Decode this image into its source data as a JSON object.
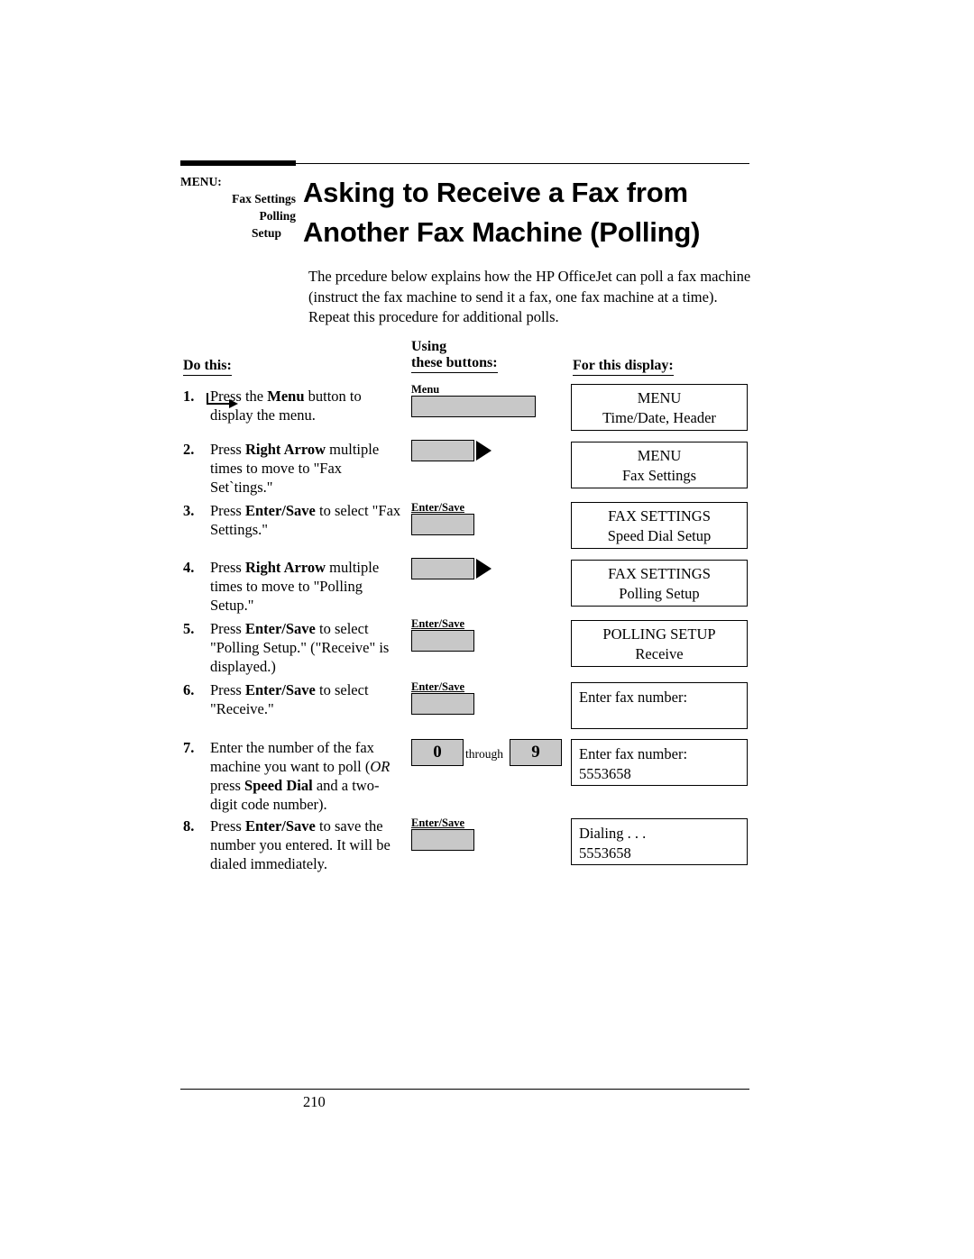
{
  "breadcrumb": {
    "line1": "MENU:",
    "line2": "Fax Settings",
    "line3": "Polling",
    "line4": "Setup"
  },
  "title": {
    "line1": "Asking to Receive a Fax from",
    "line2": "Another Fax Machine (Polling)"
  },
  "intro": "The prcedure below explains how the HP OfficeJet can poll a fax machine (instruct the fax machine to send it a fax, one fax machine at a time). Repeat this procedure for additional polls.",
  "columns": {
    "do_this": "Do this:",
    "using_line1": "Using",
    "using_line2": "these buttons:",
    "for_this_display": "For this display:"
  },
  "steps": [
    {
      "num": "1.",
      "text_parts": [
        "Press the ",
        "Menu",
        " button to display the menu."
      ],
      "button_label": "Menu",
      "display_line1": "MENU",
      "display_line2": "Time/Date, Header"
    },
    {
      "num": "2.",
      "text_parts": [
        "Press ",
        "Right Arrow",
        " multiple times to move to \"Fax Set`tings.\""
      ],
      "button_label": "",
      "display_line1": "MENU",
      "display_line2": "Fax Settings"
    },
    {
      "num": "3.",
      "text_parts": [
        "Press ",
        "Enter/Save",
        " to select \"Fax Settings.\""
      ],
      "button_label": "Enter/Save",
      "display_line1": "FAX  SETTINGS",
      "display_line2": "Speed Dial Setup"
    },
    {
      "num": "4.",
      "text_parts": [
        "Press ",
        "Right Arrow",
        " multiple times to move to \"Polling Setup.\""
      ],
      "button_label": "",
      "display_line1": "FAX  SETTINGS",
      "display_line2": "Polling Setup"
    },
    {
      "num": "5.",
      "text_parts": [
        "Press ",
        "Enter/Save",
        " to select \"Polling Setup.\" (\"Receive\" is displayed.)"
      ],
      "button_label": "Enter/Save",
      "display_line1": "POLLING  SETUP",
      "display_line2": "Receive"
    },
    {
      "num": "6.",
      "text_parts": [
        "Press ",
        "Enter/Save",
        " to select \"Receive.\""
      ],
      "button_label": "Enter/Save",
      "display_line1": "Enter fax number:",
      "display_line2": ""
    },
    {
      "num": "7.",
      "text_parts": [
        "Enter the number of the fax machine you want to poll (",
        "OR",
        " press ",
        "Speed Dial",
        " and a two-digit code number)."
      ],
      "keypad_from": "0",
      "keypad_through": "through",
      "keypad_to": "9",
      "display_line1": "Enter fax number:",
      "display_line2": "5553658"
    },
    {
      "num": "8.",
      "text_parts": [
        "Press ",
        "Enter/Save",
        " to save the number you entered. It will be dialed immediately."
      ],
      "button_label": "Enter/Save",
      "display_line1": "Dialing . . .",
      "display_line2": "5553658"
    }
  ],
  "footer": {
    "page_number": "210"
  }
}
